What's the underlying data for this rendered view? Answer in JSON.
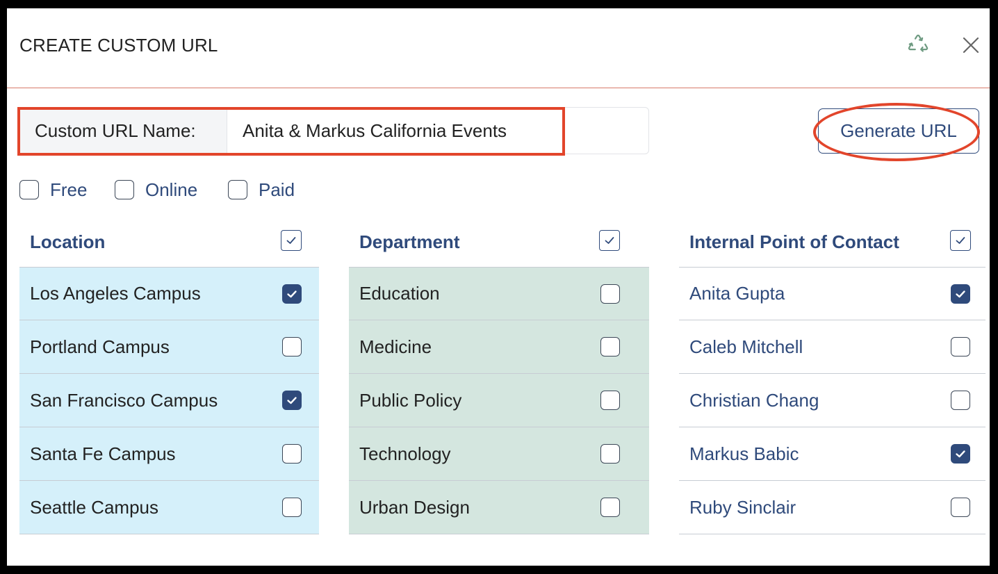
{
  "title": "CREATE CUSTOM URL",
  "name_field": {
    "label": "Custom URL Name:",
    "value": "Anita & Markus California Events"
  },
  "generate_button": "Generate URL",
  "filters": [
    {
      "label": "Free",
      "checked": false
    },
    {
      "label": "Online",
      "checked": false
    },
    {
      "label": "Paid",
      "checked": false
    }
  ],
  "columns": [
    {
      "title": "Location",
      "all_checked": true,
      "rows": [
        {
          "label": "Los Angeles Campus",
          "checked": true
        },
        {
          "label": "Portland Campus",
          "checked": false
        },
        {
          "label": "San Francisco Campus",
          "checked": true
        },
        {
          "label": "Santa Fe Campus",
          "checked": false
        },
        {
          "label": "Seattle Campus",
          "checked": false
        }
      ]
    },
    {
      "title": "Department",
      "all_checked": true,
      "rows": [
        {
          "label": "Education",
          "checked": false
        },
        {
          "label": "Medicine",
          "checked": false
        },
        {
          "label": "Public Policy",
          "checked": false
        },
        {
          "label": "Technology",
          "checked": false
        },
        {
          "label": "Urban Design",
          "checked": false
        }
      ]
    },
    {
      "title": "Internal Point of Contact",
      "all_checked": true,
      "rows": [
        {
          "label": "Anita Gupta",
          "checked": true
        },
        {
          "label": "Caleb Mitchell",
          "checked": false
        },
        {
          "label": "Christian Chang",
          "checked": false
        },
        {
          "label": "Markus Babic",
          "checked": true
        },
        {
          "label": "Ruby Sinclair",
          "checked": false
        }
      ]
    }
  ],
  "icons": {
    "recycle": "recycle-icon",
    "close": "close-icon"
  },
  "colors": {
    "accent": "#2f4a7b",
    "highlight": "#e2452b",
    "location_row_bg": "#d5f0fa",
    "department_row_bg": "#d4e6df"
  }
}
